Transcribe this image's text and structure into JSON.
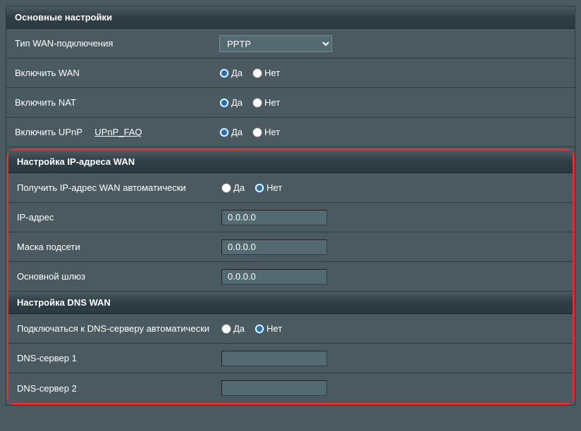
{
  "sections": {
    "main": {
      "title": "Основные настройки",
      "wan_type_label": "Тип WAN-подключения",
      "wan_type_value": "PPTP",
      "enable_wan_label": "Включить WAN",
      "enable_nat_label": "Включить NAT",
      "enable_upnp_label": "Включить UPnP",
      "upnp_faq": "UPnP_FAQ"
    },
    "wan_ip": {
      "title": "Настройка IP-адреса WAN",
      "auto_ip_label": "Получить IP-адрес WAN автоматически",
      "ip_label": "IP-адрес",
      "ip_value": "0.0.0.0",
      "mask_label": "Маска подсети",
      "mask_value": "0.0.0.0",
      "gateway_label": "Основной шлюз",
      "gateway_value": "0.0.0.0"
    },
    "dns": {
      "title": "Настройка DNS WAN",
      "auto_dns_label": "Подключаться к DNS-серверу автоматически",
      "dns1_label": "DNS-сервер 1",
      "dns1_value": "",
      "dns2_label": "DNS-сервер 2",
      "dns2_value": ""
    }
  },
  "radio": {
    "yes": "Да",
    "no": "Нет"
  }
}
